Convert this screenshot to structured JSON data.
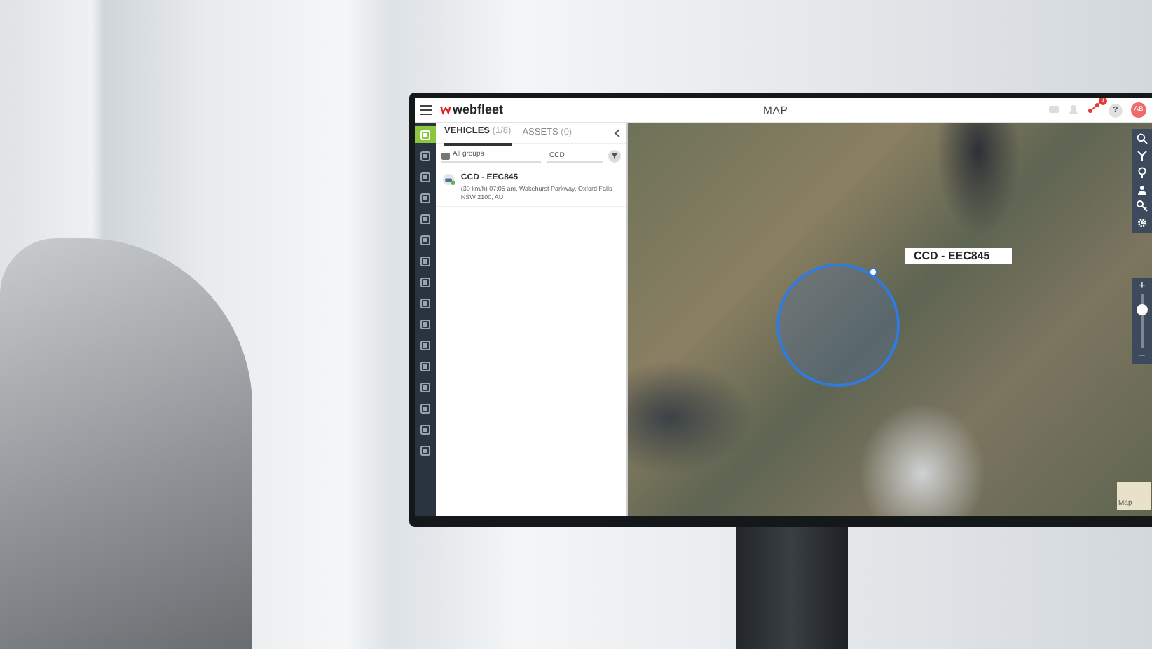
{
  "header": {
    "logo": "webfleet",
    "title": "MAP",
    "notification_count": "4",
    "help": "?",
    "avatar_initials": "AB"
  },
  "sidebar": {
    "items": [
      {
        "selected": true
      },
      {
        "selected": false
      },
      {
        "selected": false
      },
      {
        "selected": false
      },
      {
        "selected": false
      },
      {
        "selected": false
      },
      {
        "selected": false
      },
      {
        "selected": false
      },
      {
        "selected": false
      },
      {
        "selected": false
      },
      {
        "selected": false
      },
      {
        "selected": false
      },
      {
        "selected": false
      },
      {
        "selected": false
      },
      {
        "selected": false
      },
      {
        "selected": false
      }
    ]
  },
  "panel": {
    "tabs": [
      {
        "label": "VEHICLES",
        "count": "(1/8)",
        "selected": true
      },
      {
        "label": "ASSETS",
        "count": "(0)",
        "selected": false
      }
    ],
    "group_filter": {
      "value": "All groups"
    },
    "search": {
      "value": "CCD"
    },
    "vehicles": [
      {
        "name": "CCD - EEC845",
        "status": "(30 km/h) 07:05 am, Wakehurst Parkway, Oxford Falls NSW 2100, AU"
      }
    ]
  },
  "map": {
    "vehicle_label": "CCD - EEC845",
    "zoom": {
      "in": "+",
      "out": "−",
      "level": 0.7
    },
    "map_type_toggle": "Map"
  }
}
